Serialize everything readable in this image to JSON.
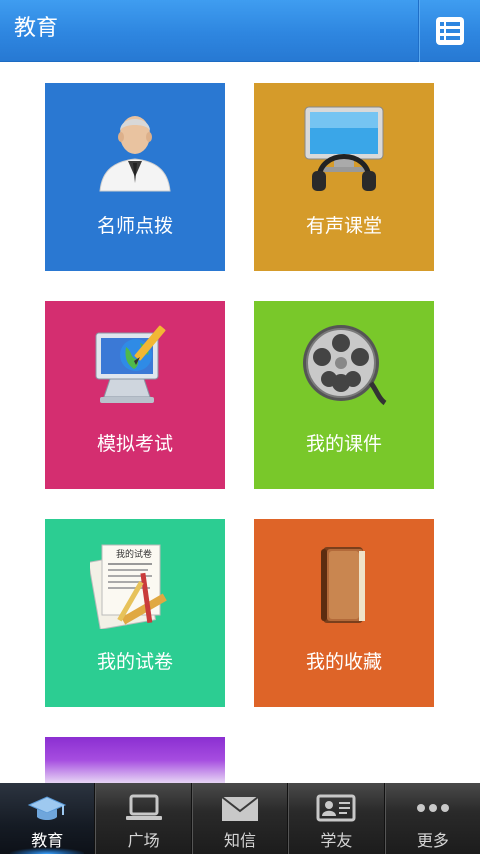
{
  "header": {
    "title": "教育",
    "menu_icon": "list-menu-icon"
  },
  "tiles": [
    {
      "label": "名师点拨",
      "icon": "teacher-icon",
      "color": "#2a78d2"
    },
    {
      "label": "有声课堂",
      "icon": "headphones-monitor-icon",
      "color": "#d59b2a"
    },
    {
      "label": "模拟考试",
      "icon": "computer-globe-pencil-icon",
      "color": "#d42e70"
    },
    {
      "label": "我的课件",
      "icon": "film-reel-icon",
      "color": "#79c82a"
    },
    {
      "label": "我的试卷",
      "icon": "exam-paper-icon",
      "color": "#2ccd92",
      "paper_title": "我的试卷"
    },
    {
      "label": "我的收藏",
      "icon": "book-icon",
      "color": "#de6428"
    },
    {
      "label": "",
      "icon": "",
      "color": "#8b2fd1"
    }
  ],
  "tabbar": {
    "active": 0,
    "items": [
      {
        "label": "教育",
        "icon": "graduation-cap-icon"
      },
      {
        "label": "广场",
        "icon": "laptop-icon"
      },
      {
        "label": "知信",
        "icon": "envelope-icon"
      },
      {
        "label": "学友",
        "icon": "id-card-icon"
      },
      {
        "label": "更多",
        "icon": "more-dots-icon"
      }
    ]
  }
}
